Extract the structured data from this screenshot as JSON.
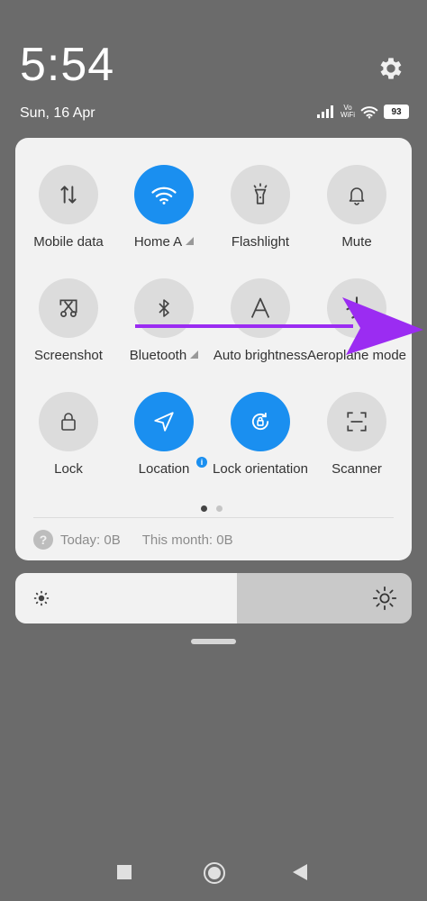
{
  "status": {
    "time": "5:54",
    "date": "Sun, 16 Apr",
    "volte_top": "Vo",
    "volte_bottom": "WiFi",
    "battery": "93"
  },
  "tiles": [
    {
      "label": "Mobile data",
      "icon": "mobile-data-icon",
      "active": false
    },
    {
      "label": "Home A",
      "icon": "wifi-icon",
      "active": true
    },
    {
      "label": "Flashlight",
      "icon": "flashlight-icon",
      "active": false
    },
    {
      "label": "Mute",
      "icon": "bell-icon",
      "active": false
    },
    {
      "label": "Screenshot",
      "icon": "screenshot-icon",
      "active": false
    },
    {
      "label": "Bluetooth",
      "icon": "bluetooth-icon",
      "active": false
    },
    {
      "label": "Auto brightness",
      "icon": "auto-brightness-icon",
      "active": false
    },
    {
      "label": "Aeroplane mode",
      "icon": "aeroplane-icon",
      "active": false
    },
    {
      "label": "Lock",
      "icon": "lock-icon",
      "active": false
    },
    {
      "label": "Location",
      "icon": "location-icon",
      "active": true
    },
    {
      "label": "Lock orientation",
      "icon": "rotation-lock-icon",
      "active": true
    },
    {
      "label": "Scanner",
      "icon": "scanner-icon",
      "active": false
    }
  ],
  "data_usage": {
    "today": "Today: 0B",
    "month": "This month: 0B"
  },
  "brightness": {
    "level": 0.56
  },
  "colors": {
    "accent": "#1a8ff0",
    "annotation_arrow": "#9b2cf2"
  }
}
